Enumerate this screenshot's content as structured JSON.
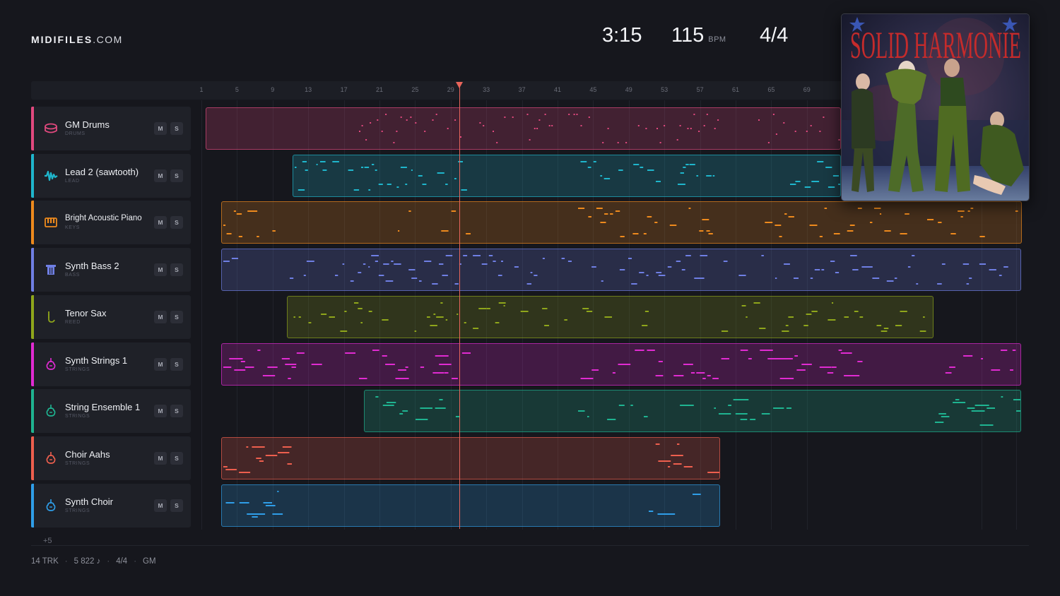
{
  "brand": {
    "name": "MIDIFILES",
    "suffix": ".COM"
  },
  "transport": {
    "time": "3:15",
    "tempo": "115",
    "tempo_unit": "BPM",
    "time_signature": "4/4"
  },
  "ruler": {
    "ticks": [
      "1",
      "5",
      "9",
      "13",
      "17",
      "21",
      "25",
      "29",
      "33",
      "37",
      "41",
      "45",
      "49",
      "53",
      "57",
      "61",
      "65",
      "69"
    ]
  },
  "playhead": {
    "bar": 30
  },
  "tracks": [
    {
      "name": "GM Drums",
      "category": "DRUMS",
      "color": "#e1497e",
      "icon": "drum-icon",
      "mute": "M",
      "solo": "S"
    },
    {
      "name": "Lead 2 (sawtooth)",
      "category": "LEAD",
      "color": "#1fb6cc",
      "icon": "waveform-icon",
      "mute": "M",
      "solo": "S"
    },
    {
      "name": "Bright Acoustic Piano",
      "category": "KEYS",
      "color": "#ee8a1d",
      "icon": "piano-keys-icon",
      "mute": "M",
      "solo": "S"
    },
    {
      "name": "Synth Bass 2",
      "category": "BASS",
      "color": "#6f7fe4",
      "icon": "bass-icon",
      "mute": "M",
      "solo": "S"
    },
    {
      "name": "Tenor Sax",
      "category": "REED",
      "color": "#8fa61b",
      "icon": "saxophone-icon",
      "mute": "M",
      "solo": "S"
    },
    {
      "name": "Synth Strings 1",
      "category": "STRINGS",
      "color": "#e12bd2",
      "icon": "violin-icon",
      "mute": "M",
      "solo": "S"
    },
    {
      "name": "String Ensemble 1",
      "category": "STRINGS",
      "color": "#1fb491",
      "icon": "violin-icon",
      "mute": "M",
      "solo": "S"
    },
    {
      "name": "Choir Aahs",
      "category": "STRINGS",
      "color": "#ee5f4e",
      "icon": "violin-icon",
      "mute": "M",
      "solo": "S"
    },
    {
      "name": "Synth Choir",
      "category": "STRINGS",
      "color": "#2f9ee8",
      "icon": "violin-icon",
      "mute": "M",
      "solo": "S"
    }
  ],
  "more_tracks": "+5",
  "status": {
    "tracks": "14 TRK",
    "notes": "5 822 ♪",
    "signature": "4/4",
    "standard": "GM"
  },
  "cover": {
    "title": "SOLID HARMONIE"
  }
}
